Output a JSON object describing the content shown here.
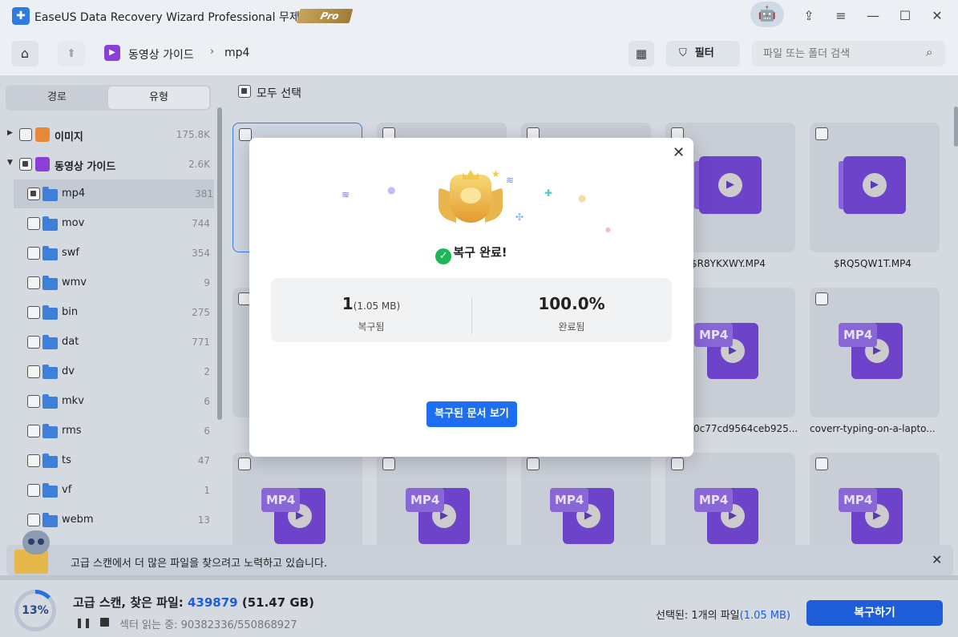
{
  "titlebar": {
    "title": "EaseUS Data Recovery Wizard Professional 무제한",
    "pro_badge": "Pro"
  },
  "toolbar": {
    "breadcrumb_category": "동영상 가이드",
    "breadcrumb_folder": "mp4",
    "filter_label": "필터",
    "search_placeholder": "파일 또는 폴더 검색"
  },
  "sidebar": {
    "tab_path": "경로",
    "tab_type": "유형",
    "categories": [
      {
        "label": "이미지",
        "count": "175.8K"
      },
      {
        "label": "동영상 가이드",
        "count": "2.6K"
      }
    ],
    "folders": [
      {
        "label": "mp4",
        "count": "381"
      },
      {
        "label": "mov",
        "count": "744"
      },
      {
        "label": "swf",
        "count": "354"
      },
      {
        "label": "wmv",
        "count": "9"
      },
      {
        "label": "bin",
        "count": "275"
      },
      {
        "label": "dat",
        "count": "771"
      },
      {
        "label": "dv",
        "count": "2"
      },
      {
        "label": "mkv",
        "count": "6"
      },
      {
        "label": "rms",
        "count": "6"
      },
      {
        "label": "ts",
        "count": "47"
      },
      {
        "label": "vf",
        "count": "1"
      },
      {
        "label": "webm",
        "count": "13"
      }
    ]
  },
  "main": {
    "select_all": "모두 선택",
    "files": [
      "$R8YKXWY.MP4",
      "$RQ5QW1T.MP4",
      "0c77cd9564ceb925...",
      "coverr-typing-on-a-lapto..."
    ],
    "mp4_tag": "MP4"
  },
  "notice": {
    "text": "고급 스캔에서 더 많은 파일을 찾으려고 노력하고 있습니다."
  },
  "status": {
    "progress_label": "13%",
    "progress": 0.13,
    "scan_prefix": "고급 스캔, 찾은 파일:",
    "found_count": "439879",
    "found_size": "(51.47 GB)",
    "sector": "섹터 읽는 중: 90382336/550868927",
    "selected_prefix": "선택된: 1개의 파일",
    "selected_size": "(1.05 MB)",
    "recover_button": "복구하기"
  },
  "modal": {
    "title": "복구 완료!",
    "recovered_count": "1",
    "recovered_size": "(1.05 MB)",
    "recovered_label": "복구됨",
    "complete_value": "100.0%",
    "complete_label": "완료됨",
    "view_button": "복구된 문서 보기"
  },
  "colors": {
    "accent": "#1d5ed8",
    "success": "#1db75a",
    "video_purple": "#6c43c9"
  }
}
